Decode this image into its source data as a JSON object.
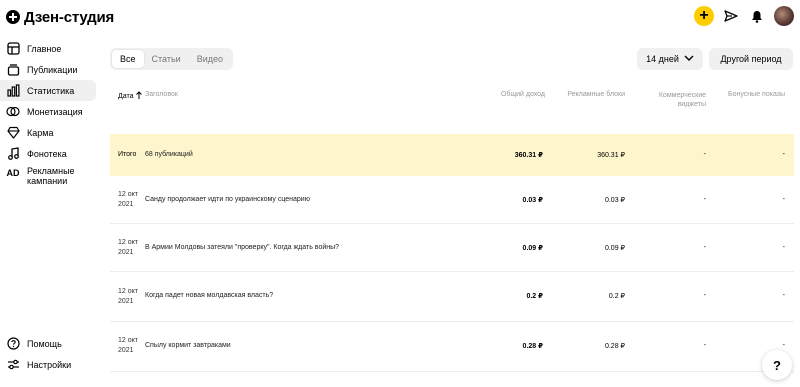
{
  "app": {
    "logo_text": "Дзен-студия"
  },
  "header": {
    "add_label": "+"
  },
  "sidebar": {
    "items": [
      {
        "label": "Главное",
        "icon": "layout-icon"
      },
      {
        "label": "Публикации",
        "icon": "publications-icon"
      },
      {
        "label": "Статистика",
        "icon": "stats-icon"
      },
      {
        "label": "Монетизация",
        "icon": "money-icon"
      },
      {
        "label": "Карма",
        "icon": "karma-icon"
      },
      {
        "label": "Фонотека",
        "icon": "music-icon"
      },
      {
        "label": "Рекламные кампании",
        "icon": "ad-icon",
        "icon_text": "AD"
      }
    ],
    "bottom": [
      {
        "label": "Помощь",
        "icon": "help-icon"
      },
      {
        "label": "Настройки",
        "icon": "settings-icon"
      }
    ]
  },
  "filters": {
    "tabs": [
      "Все",
      "Статьи",
      "Видео"
    ],
    "active_tab": "Все",
    "period": "14 дней",
    "other_period": "Другой период"
  },
  "table": {
    "columns": {
      "date": "Дата",
      "title": "Заголовок",
      "income": "Общий доход",
      "ad_blocks": "Рекламные блоки",
      "commercial": "Коммерческие виджеты",
      "bonus": "Бонусные показы"
    },
    "total": {
      "label": "Итого",
      "count": "68 публикаций",
      "income": "360.31 ₽",
      "ad_blocks": "360.31 ₽",
      "commercial": "-",
      "bonus": "-"
    },
    "rows": [
      {
        "date_day": "12 окт",
        "date_year": "2021",
        "title": "Санду продолжает идти по украинскому сценарию",
        "income": "0.03 ₽",
        "ad_blocks": "0.03 ₽",
        "commercial": "-",
        "bonus": "-"
      },
      {
        "date_day": "12 окт",
        "date_year": "2021",
        "title": "В Армии Молдовы затеяли \"проверку\". Когда ждать войны?",
        "income": "0.09 ₽",
        "ad_blocks": "0.09 ₽",
        "commercial": "-",
        "bonus": "-"
      },
      {
        "date_day": "12 окт",
        "date_year": "2021",
        "title": "Когда падет новая молдавская власть?",
        "income": "0.2 ₽",
        "ad_blocks": "0.2 ₽",
        "commercial": "-",
        "bonus": "-"
      },
      {
        "date_day": "12 окт",
        "date_year": "2021",
        "title": "Спылу кормит завтраками",
        "income": "0.28 ₽",
        "ad_blocks": "0.28 ₽",
        "commercial": "-",
        "bonus": "-"
      }
    ]
  },
  "help_fab": "?",
  "colors": {
    "accent": "#ffcc00",
    "total_row_bg": "#fdf5cc"
  }
}
